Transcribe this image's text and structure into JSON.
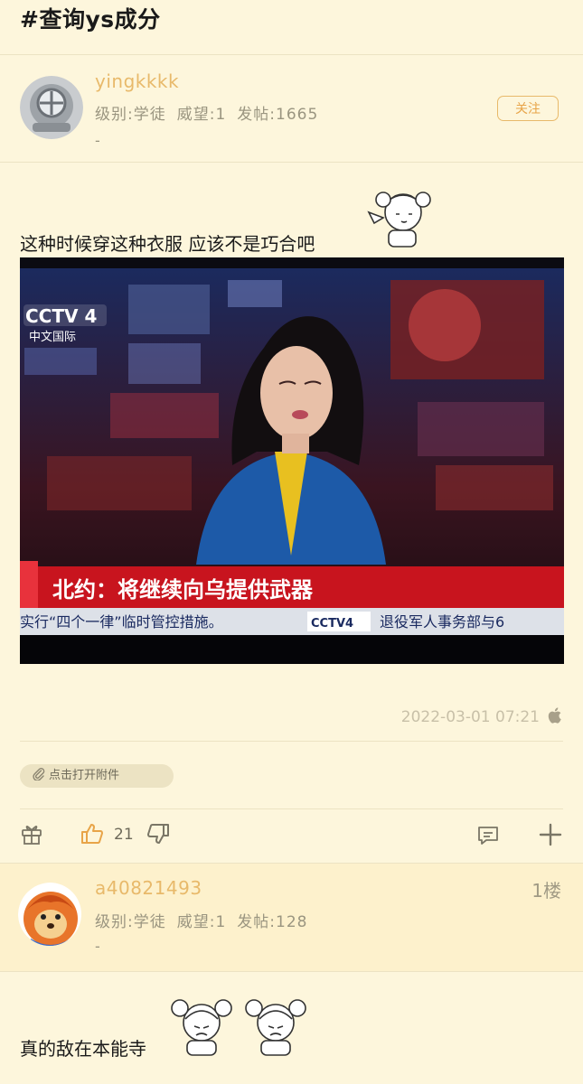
{
  "topic": {
    "hashtag": "#查询ys成分"
  },
  "post": {
    "author": {
      "username": "yingkkkk",
      "level": "级别:学徒",
      "prestige": "威望:1",
      "posts": "发帖:1665",
      "signature": "-"
    },
    "follow_label": "关注",
    "text": "这种时候穿这种衣服 应该不是巧合吧",
    "image": {
      "channel_logo": "CCTV 4",
      "channel_sub": "中文国际",
      "headline": "北约：将继续向乌提供武器",
      "ticker_left": "实行“四个一律”临时管控措施。",
      "ticker_logo": "CCTV4",
      "ticker_right": "退役军人事务部与6"
    },
    "timestamp": "2022-03-01 07:21",
    "attachment_label": "点击打开附件",
    "likes": "21"
  },
  "reply": {
    "author": {
      "username": "a40821493",
      "level": "级别:学徒",
      "prestige": "威望:1",
      "posts": "发帖:128",
      "signature": "-"
    },
    "floor": "1楼",
    "text": "真的敌在本能寺"
  },
  "colors": {
    "background": "#fdf6dc",
    "username": "#e8b96a",
    "follow_border": "#e8b96a",
    "headline_bar": "#c8141e"
  }
}
